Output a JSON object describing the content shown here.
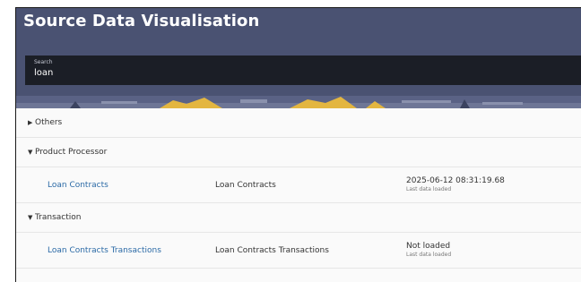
{
  "app": {
    "title": "Source Data Visualisation"
  },
  "search": {
    "label": "Search",
    "value": "loan"
  },
  "groups": [
    {
      "label": "Others",
      "expanded": false
    },
    {
      "label": "Product Processor",
      "expanded": true
    },
    {
      "label": "Transaction",
      "expanded": true
    }
  ],
  "rows": [
    {
      "name": "Loan Contracts",
      "description": "Loan Contracts",
      "status": "2025-06-12 08:31:19.68",
      "status_caption": "Last data loaded"
    },
    {
      "name": "Loan Contracts Transactions",
      "description": "Loan Contracts Transactions",
      "status": "Not loaded",
      "status_caption": "Last data loaded"
    }
  ],
  "icons": {
    "collapsed": "caret-right-icon",
    "expanded": "caret-down-icon"
  },
  "colors": {
    "header_bg": "#4a5272",
    "search_bg": "#1b1e26",
    "link": "#2b6aa6",
    "banner_accent": "#e3b640"
  }
}
